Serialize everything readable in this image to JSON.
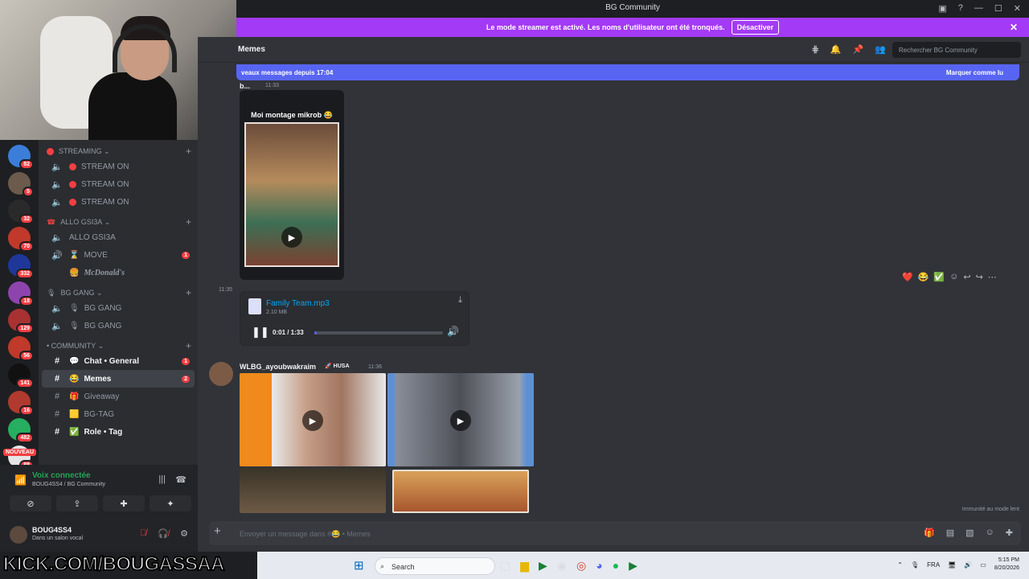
{
  "window": {
    "title": "BG Community"
  },
  "streamer_bar": {
    "text": "Le mode streamer est activé. Les noms d'utilisateur ont été tronqués.",
    "button": "Désactiver"
  },
  "servers": [
    {
      "badge": "82",
      "color": "#3b7dd8"
    },
    {
      "badge": "5",
      "color": "#6c5b4d"
    },
    {
      "badge": "32",
      "color": "#2a2a2a"
    },
    {
      "badge": "70",
      "color": "#c0392b"
    },
    {
      "badge": "332",
      "color": "#1e3799"
    },
    {
      "badge": "18",
      "color": "#8e44ad"
    },
    {
      "badge": "129",
      "color": "#a83232"
    },
    {
      "badge": "56",
      "color": "#c0392b"
    },
    {
      "badge": "141",
      "color": "#111111"
    },
    {
      "badge": "16",
      "color": "#b03a2e"
    },
    {
      "badge": "482",
      "color": "#27ae60"
    },
    {
      "badge": "88",
      "color": "#e5e5e5"
    },
    {
      "badge": "",
      "color": "#d5f5e3"
    }
  ],
  "nouveau": "NOUVEAU",
  "sidebar": {
    "categories": [
      {
        "name": "STREAMING",
        "channels": [
          {
            "name": "STREAM ON"
          },
          {
            "name": "STREAM ON"
          },
          {
            "name": "STREAM ON"
          }
        ]
      },
      {
        "name": "ALLO GSI3A",
        "channels": [
          {
            "name": "ALLO GSI3A"
          },
          {
            "name": "MOVE",
            "badge": "1"
          },
          {
            "name": "McDonald's"
          }
        ]
      },
      {
        "name": "BG GANG",
        "channels": [
          {
            "name": "BG GANG"
          },
          {
            "name": "BG GANG"
          }
        ]
      },
      {
        "name": "COMMUNITY",
        "channels": [
          {
            "name": "Chat • General",
            "badge": "1"
          },
          {
            "name": "Memes",
            "badge": "2"
          },
          {
            "name": "Giveaway"
          },
          {
            "name": "BG-TAG"
          },
          {
            "name": "Role • Tag"
          }
        ]
      }
    ]
  },
  "voice": {
    "status": "Voix connectée",
    "server": "BOUG4SS4 / BG Community"
  },
  "user": {
    "name": "BOUG4SS4",
    "status": "Dans un salon vocal"
  },
  "channel": {
    "name": "Memes",
    "search_placeholder": "Rechercher BG Community"
  },
  "new_messages": {
    "text": "veaux messages depuis 17:04",
    "action": "Marquer comme lu"
  },
  "messages": {
    "m1": {
      "author": "b...",
      "time": "11:33",
      "caption": "Moi montage mikrob 😂"
    },
    "m2": {
      "time": "11:35",
      "file_name": "Family Team.mp3",
      "file_size": "2.10 MB",
      "playback": "0:01 / 1:33",
      "progress": 0.01
    },
    "m3": {
      "author": "WLBG_ayoubwakraim",
      "tag": "HUSA",
      "time": "11:36"
    }
  },
  "immunity_note": "Immunité au mode lent",
  "composer": {
    "placeholder": "Envoyer un message dans #😂 • Memes"
  },
  "overlay": {
    "kick": "KICK.COM/BOUGASSAA"
  },
  "taskbar": {
    "search": "Search",
    "lang": "FRA",
    "time": "5:15 PM",
    "date": "8/20/2026"
  }
}
